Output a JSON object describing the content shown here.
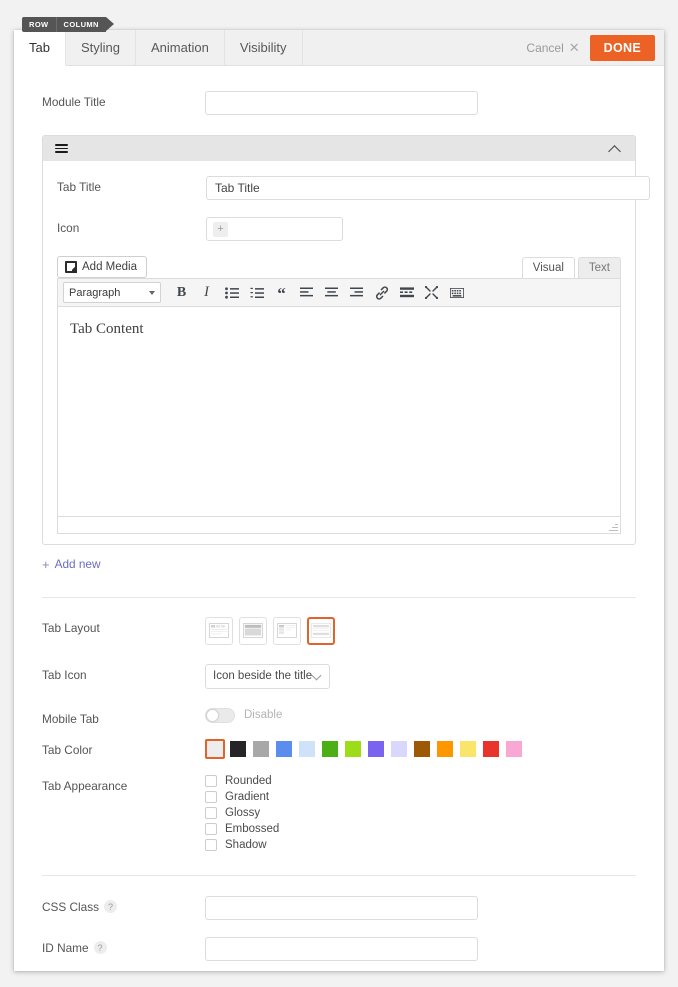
{
  "breadcrumb": {
    "items": [
      "ROW",
      "COLUMN"
    ]
  },
  "tabbar": {
    "tabs": [
      {
        "label": "Tab",
        "active": true
      },
      {
        "label": "Styling",
        "active": false
      },
      {
        "label": "Animation",
        "active": false
      },
      {
        "label": "Visibility",
        "active": false
      }
    ],
    "cancel_label": "Cancel",
    "cancel_icon": "close-icon",
    "done_label": "DONE",
    "done_color": "#ec6224"
  },
  "module_title": {
    "label": "Module Title",
    "value": "",
    "placeholder": ""
  },
  "accordion": {
    "handle_icon": "drag-handle-icon",
    "collapse_icon": "chevron-up-icon",
    "tab_title": {
      "label": "Tab Title",
      "value": "Tab Title"
    },
    "icon_field": {
      "label": "Icon",
      "value": "",
      "add_icon": "plus-icon"
    },
    "editor": {
      "add_media_label": "Add Media",
      "add_media_icon": "media-icon",
      "mode_tabs": [
        {
          "label": "Visual",
          "active": true
        },
        {
          "label": "Text",
          "active": false
        }
      ],
      "format_select": "Paragraph",
      "toolbar_icons": [
        "bold-icon",
        "italic-icon",
        "bulleted-list-icon",
        "numbered-list-icon",
        "blockquote-icon",
        "align-left-icon",
        "align-center-icon",
        "align-right-icon",
        "link-icon",
        "read-more-icon",
        "fullscreen-icon",
        "toolbar-toggle-icon"
      ],
      "content": "Tab Content"
    }
  },
  "add_new": {
    "label": "Add new",
    "icon": "plus-icon"
  },
  "tab_layout": {
    "label": "Tab Layout",
    "options": [
      {
        "name": "layout-top-tabs",
        "selected": false
      },
      {
        "name": "layout-filled",
        "selected": false
      },
      {
        "name": "layout-left-vertical",
        "selected": false
      },
      {
        "name": "layout-accordion",
        "selected": true
      }
    ],
    "selected_color": "#e2622b"
  },
  "tab_icon": {
    "label": "Tab Icon",
    "value": "Icon beside the title",
    "chevron": "chevron-down-icon"
  },
  "mobile_tab": {
    "label": "Mobile Tab",
    "state_label": "Disable",
    "enabled": false
  },
  "tab_color": {
    "label": "Tab Color",
    "selected_index": 0,
    "swatches": [
      "#ededed",
      "#252528",
      "#a8a8a8",
      "#5b8def",
      "#cfe2f8",
      "#4caf16",
      "#9ddc18",
      "#7a63ee",
      "#d9d7fb",
      "#9c5a06",
      "#fd9700",
      "#fbe46a",
      "#e8342a",
      "#f9a7d3"
    ]
  },
  "tab_appearance": {
    "label": "Tab Appearance",
    "options": [
      {
        "label": "Rounded",
        "checked": false
      },
      {
        "label": "Gradient",
        "checked": false
      },
      {
        "label": "Glossy",
        "checked": false
      },
      {
        "label": "Embossed",
        "checked": false
      },
      {
        "label": "Shadow",
        "checked": false
      }
    ]
  },
  "css_class": {
    "label": "CSS Class",
    "help": "?",
    "value": ""
  },
  "id_name": {
    "label": "ID Name",
    "help": "?",
    "value": ""
  }
}
